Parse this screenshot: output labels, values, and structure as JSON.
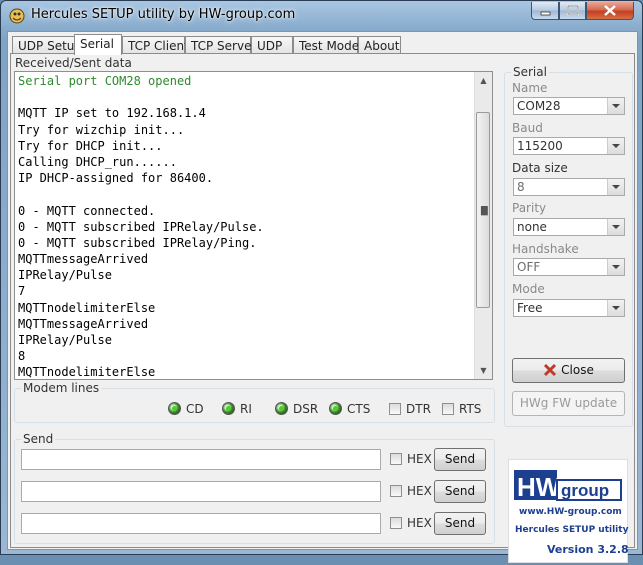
{
  "window": {
    "title": "Hercules SETUP utility by HW-group.com"
  },
  "tabs": [
    {
      "label": "UDP Setup"
    },
    {
      "label": "Serial"
    },
    {
      "label": "TCP Client"
    },
    {
      "label": "TCP Server"
    },
    {
      "label": "UDP"
    },
    {
      "label": "Test Mode"
    },
    {
      "label": "About"
    }
  ],
  "received": {
    "label": "Received/Sent data",
    "lines": [
      {
        "text": "Serial port COM28 opened",
        "color": "#2e8b2e"
      },
      {
        "text": "",
        "color": "#000000"
      },
      {
        "text": "MQTT IP set to 192.168.1.4",
        "color": "#000000"
      },
      {
        "text": "Try for wizchip init...",
        "color": "#000000"
      },
      {
        "text": "Try for DHCP init...",
        "color": "#000000"
      },
      {
        "text": "Calling DHCP_run......",
        "color": "#000000"
      },
      {
        "text": "IP DHCP-assigned for 86400.",
        "color": "#000000"
      },
      {
        "text": "",
        "color": "#000000"
      },
      {
        "text": "0 - MQTT connected.",
        "color": "#000000"
      },
      {
        "text": "0 - MQTT subscribed IPRelay/Pulse.",
        "color": "#000000"
      },
      {
        "text": "0 - MQTT subscribed IPRelay/Ping.",
        "color": "#000000"
      },
      {
        "text": "MQTTmessageArrived",
        "color": "#000000"
      },
      {
        "text": "IPRelay/Pulse",
        "color": "#000000"
      },
      {
        "text": "7",
        "color": "#000000"
      },
      {
        "text": "MQTTnodelimiterElse",
        "color": "#000000"
      },
      {
        "text": "MQTTmessageArrived",
        "color": "#000000"
      },
      {
        "text": "IPRelay/Pulse",
        "color": "#000000"
      },
      {
        "text": "8",
        "color": "#000000"
      },
      {
        "text": "MQTTnodelimiterElse",
        "color": "#000000"
      }
    ]
  },
  "modem": {
    "legend": "Modem lines",
    "cd": "CD",
    "ri": "RI",
    "dsr": "DSR",
    "cts": "CTS",
    "dtr": "DTR",
    "rts": "RTS"
  },
  "serial": {
    "legend": "Serial",
    "name_label": "Name",
    "name_value": "COM28",
    "baud_label": "Baud",
    "baud_value": "115200",
    "datasize_label": "Data size",
    "datasize_value": "8",
    "parity_label": "Parity",
    "parity_value": "none",
    "handshake_label": "Handshake",
    "handshake_value": "OFF",
    "mode_label": "Mode",
    "mode_value": "Free",
    "close_label": "Close",
    "fw_update_label": "HWg FW update"
  },
  "send": {
    "legend": "Send",
    "rows": [
      {
        "value": "",
        "hex_label": "HEX",
        "button_label": "Send"
      },
      {
        "value": "",
        "hex_label": "HEX",
        "button_label": "Send"
      },
      {
        "value": "",
        "hex_label": "HEX",
        "button_label": "Send"
      }
    ]
  },
  "logo": {
    "brand": "HWgroup",
    "url": "www.HW-group.com",
    "product": "Hercules SETUP utility",
    "version": "Version  3.2.8"
  },
  "colors": {
    "green_text": "#2e8b2e",
    "logo_blue": "#1c3f8f",
    "close_icon": "#c0392b"
  }
}
